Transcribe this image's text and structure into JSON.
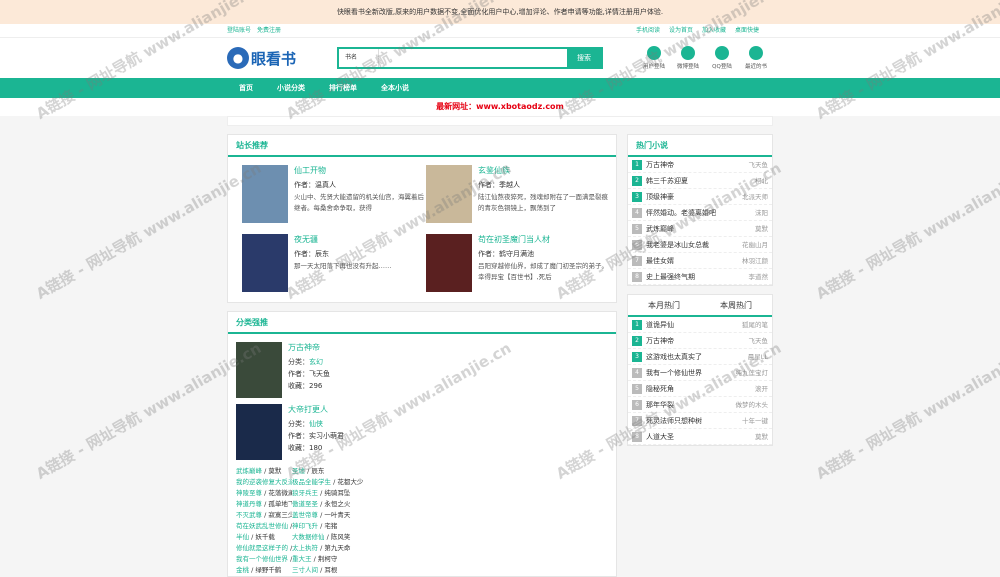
{
  "notice": "快眼看书全新改版,原来的用户数据不变,全面优化用户中心,增加评论、作者申请等功能,详情注册用户体验.",
  "topbar": {
    "login": "登陆账号",
    "register": "免费注册",
    "mobile": "手机阅读",
    "home": "设为首页",
    "fav": "加入收藏",
    "desktop": "桌面快捷"
  },
  "logo": "眼看书",
  "search": {
    "cat": "书名",
    "placeholder": "",
    "btn": "搜索"
  },
  "icons": [
    "用户登陆",
    "微博登陆",
    "QQ登陆",
    "最近的书"
  ],
  "nav": [
    "首页",
    "小说分类",
    "排行榜单",
    "全本小说"
  ],
  "newurl": "最新网址：www.xbotaodz.com",
  "reco": {
    "title": "站长推荐",
    "books": [
      {
        "t": "仙工开物",
        "a": "作者：温真人",
        "d": "火山中、先贤大能遗留的机关仙宫，海翼着后继者。每桑舍命争取，获得"
      },
      {
        "t": "玄鉴仙族",
        "a": "作者：季越人",
        "d": "陆江仙熬夜猝死，残魂却附在了一面满是裂痕的青灰色铜镜上，飘荡到了"
      },
      {
        "t": "夜无疆",
        "a": "作者：辰东",
        "d": "那一天太阳落下再也没有升起……"
      },
      {
        "t": "苟在初圣魔门当人材",
        "a": "作者：鹤守月满池",
        "d": "吕阳穿越修仙界，却成了魔门初圣宗的弟子。幸得异宝【百世书】,死后"
      }
    ]
  },
  "hot": {
    "title": "热门小说",
    "items": [
      [
        "万古神帝",
        "飞天鱼"
      ],
      [
        "韩三千苏迎夏",
        "柯北"
      ],
      [
        "顶级神豪",
        "北派天师"
      ],
      [
        "怦然婚动。老婆离婚吧",
        "沫阳"
      ],
      [
        "武炼巅峰",
        "莫默"
      ],
      [
        "我老婆是冰山女总裁",
        "花幽山月"
      ],
      [
        "最佳女婿",
        "林羽江颜"
      ],
      [
        "史上最强终气期",
        "李道然"
      ]
    ]
  },
  "cls": {
    "title": "分类强推",
    "books": [
      {
        "t": "万古神帝",
        "c": "分类：",
        "cv": "玄幻",
        "a": "作者：飞天鱼",
        "n": "收藏：296"
      },
      {
        "t": "大帝打更人",
        "c": "分类：",
        "cv": "仙侠",
        "a": "作者：实习小萌君",
        "n": "收藏：180"
      }
    ],
    "links1": [
      "武炼巅峰 / 莫默",
      "我的逆袭修复大反派 / 谭生",
      "神陵至尊 / 花落微澜",
      "神道丹尊 / 孤单地飞",
      "不灭武尊 / 寂寞三少"
    ],
    "links1b": [
      "圣墟 / 辰东",
      "极品全能学生 / 花都大少",
      "狼牙兵王 / 纯骑耳坠",
      "傲道至圣 / 永恒之火",
      "盖世帝尊 / 一叶青天"
    ],
    "links2": [
      "苟在妖武乱世修仙 / 文抄公",
      "半仙 / 妖千载",
      "修仙就是这样子的 / 凤嘲凰",
      "我有一个修仙世界 / 纯九莲",
      "金桃 / 绿野千鹤"
    ],
    "links2b": [
      "神印飞升 / 宅猪",
      "大数据修仙 / 陈风笑",
      "太上执符 / 第九天命",
      "重大王 / 荆柯守",
      "三寸人间 / 耳根"
    ]
  },
  "month": {
    "tabs": [
      "本月热门",
      "本周热门"
    ],
    "items": [
      [
        "道诡异仙",
        "狐尾的笔"
      ],
      [
        "万古神帝",
        "飞天鱼"
      ],
      [
        "这游戏也太真实了",
        "晨星LL"
      ],
      [
        "我有一个修仙世界",
        "纯九莲宝灯"
      ],
      [
        "隐秘死角",
        "滚开"
      ],
      [
        "那年华裂",
        "做梦的木头"
      ],
      [
        "死灵法师只想种树",
        "十年一键"
      ],
      [
        "人道大圣",
        "莫默"
      ]
    ]
  },
  "watermark": "A链接 - 网址导航 www.alianjie.cn"
}
